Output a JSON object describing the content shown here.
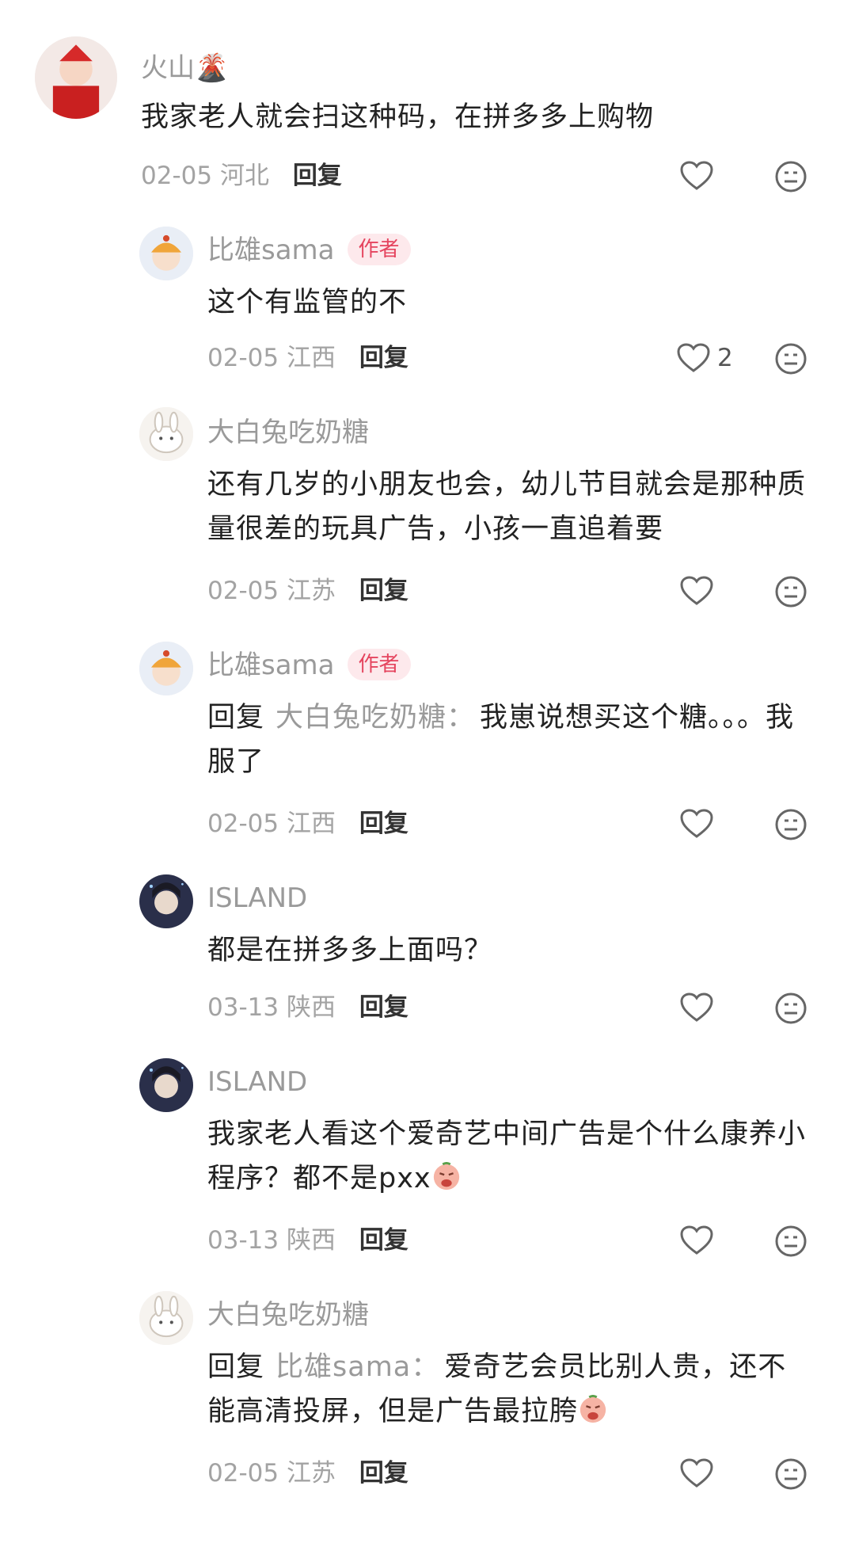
{
  "comments": [
    {
      "user": "火山🌋",
      "author_badge": "",
      "text": "我家老人就会扫这种码，在拼多多上购物",
      "date": "02-05",
      "location": "河北",
      "reply": "回复",
      "likes": ""
    },
    {
      "user": "比雄sama",
      "author_badge": "作者",
      "text": "这个有监管的不",
      "date": "02-05",
      "location": "江西",
      "reply": "回复",
      "likes": "2"
    },
    {
      "user": "大白兔吃奶糖",
      "author_badge": "",
      "text": "还有几岁的小朋友也会，幼儿节目就会是那种质量很差的玩具广告，小孩一直追着要",
      "date": "02-05",
      "location": "江苏",
      "reply": "回复",
      "likes": ""
    },
    {
      "user": "比雄sama",
      "author_badge": "作者",
      "reply_prefix": "回复",
      "reply_to": "大白兔吃奶糖：",
      "text": "我崽说想买这个糖。。。我服了",
      "date": "02-05",
      "location": "江西",
      "reply": "回复",
      "likes": ""
    },
    {
      "user": "ISLAND",
      "author_badge": "",
      "text": "都是在拼多多上面吗？",
      "date": "03-13",
      "location": "陕西",
      "reply": "回复",
      "likes": ""
    },
    {
      "user": "ISLAND",
      "author_badge": "",
      "text": "我家老人看这个爱奇艺中间广告是个什么康养小程序？都不是pxx",
      "date": "03-13",
      "location": "陕西",
      "reply": "回复",
      "likes": ""
    },
    {
      "user": "大白兔吃奶糖",
      "author_badge": "",
      "reply_prefix": "回复",
      "reply_to": "比雄sama：",
      "text": "爱奇艺会员比别人贵，还不能高清投屏，但是广告最拉胯",
      "date": "02-05",
      "location": "江苏",
      "reply": "回复",
      "likes": ""
    }
  ],
  "icons": {
    "like": "heart-outline-icon",
    "dislike": "meh-face-icon"
  },
  "colors": {
    "username": "#9a9a9a",
    "badge_bg": "#fde9ec",
    "badge_text": "#e5455f",
    "meta": "#a3a3a3"
  }
}
